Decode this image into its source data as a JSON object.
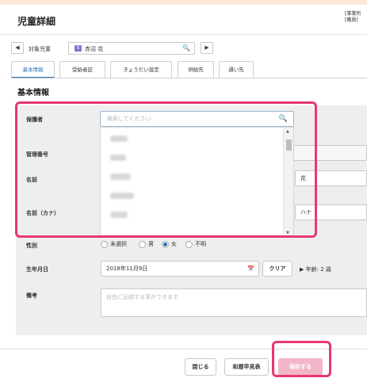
{
  "page": {
    "title": "児童詳細",
    "corner_info": "[事業所\n[職員]"
  },
  "child_selector": {
    "label": "対象児童",
    "badge": "S",
    "child_name": "赤沼 花",
    "prev_symbol": "◀",
    "next_symbol": "▶",
    "search_symbol": "🔍"
  },
  "tabs": [
    {
      "label": "基本情報",
      "active": true
    },
    {
      "label": "受給者証"
    },
    {
      "label": "きょうだい設定"
    },
    {
      "label": "供給先"
    },
    {
      "label": "通い先"
    }
  ],
  "section_title": "基本情報",
  "form": {
    "guardian": {
      "label": "保護者",
      "placeholder": "検索してください",
      "search_symbol": "🔍"
    },
    "management_number": {
      "label": "管理番号"
    },
    "name": {
      "label": "名前",
      "value_partial": "花"
    },
    "name_kana": {
      "label": "名前（カナ）",
      "value_partial": "ハナ"
    },
    "gender": {
      "label": "性別",
      "options": [
        "未選択",
        "男",
        "女",
        "不明"
      ],
      "selected": "女"
    },
    "birthday": {
      "label": "生年月日",
      "value": "2018年11月9日",
      "clear_label": "クリア",
      "age_text": "▶ 年齢: 2 歳",
      "calendar_symbol": "📅"
    },
    "notes": {
      "label": "備考",
      "placeholder": "自由に記録する事ができます"
    }
  },
  "dropdown": {
    "scroll_up": "▲",
    "scroll_down": "▼"
  },
  "footer": {
    "close_label": "閉じる",
    "print_label": "和暦早見表",
    "save_label": "保存する"
  },
  "colors": {
    "accent_blue": "#2a6fb5",
    "highlight_pink": "#e8386d",
    "save_disabled": "#f3b6c8",
    "badge_purple": "#8d6fcf"
  }
}
